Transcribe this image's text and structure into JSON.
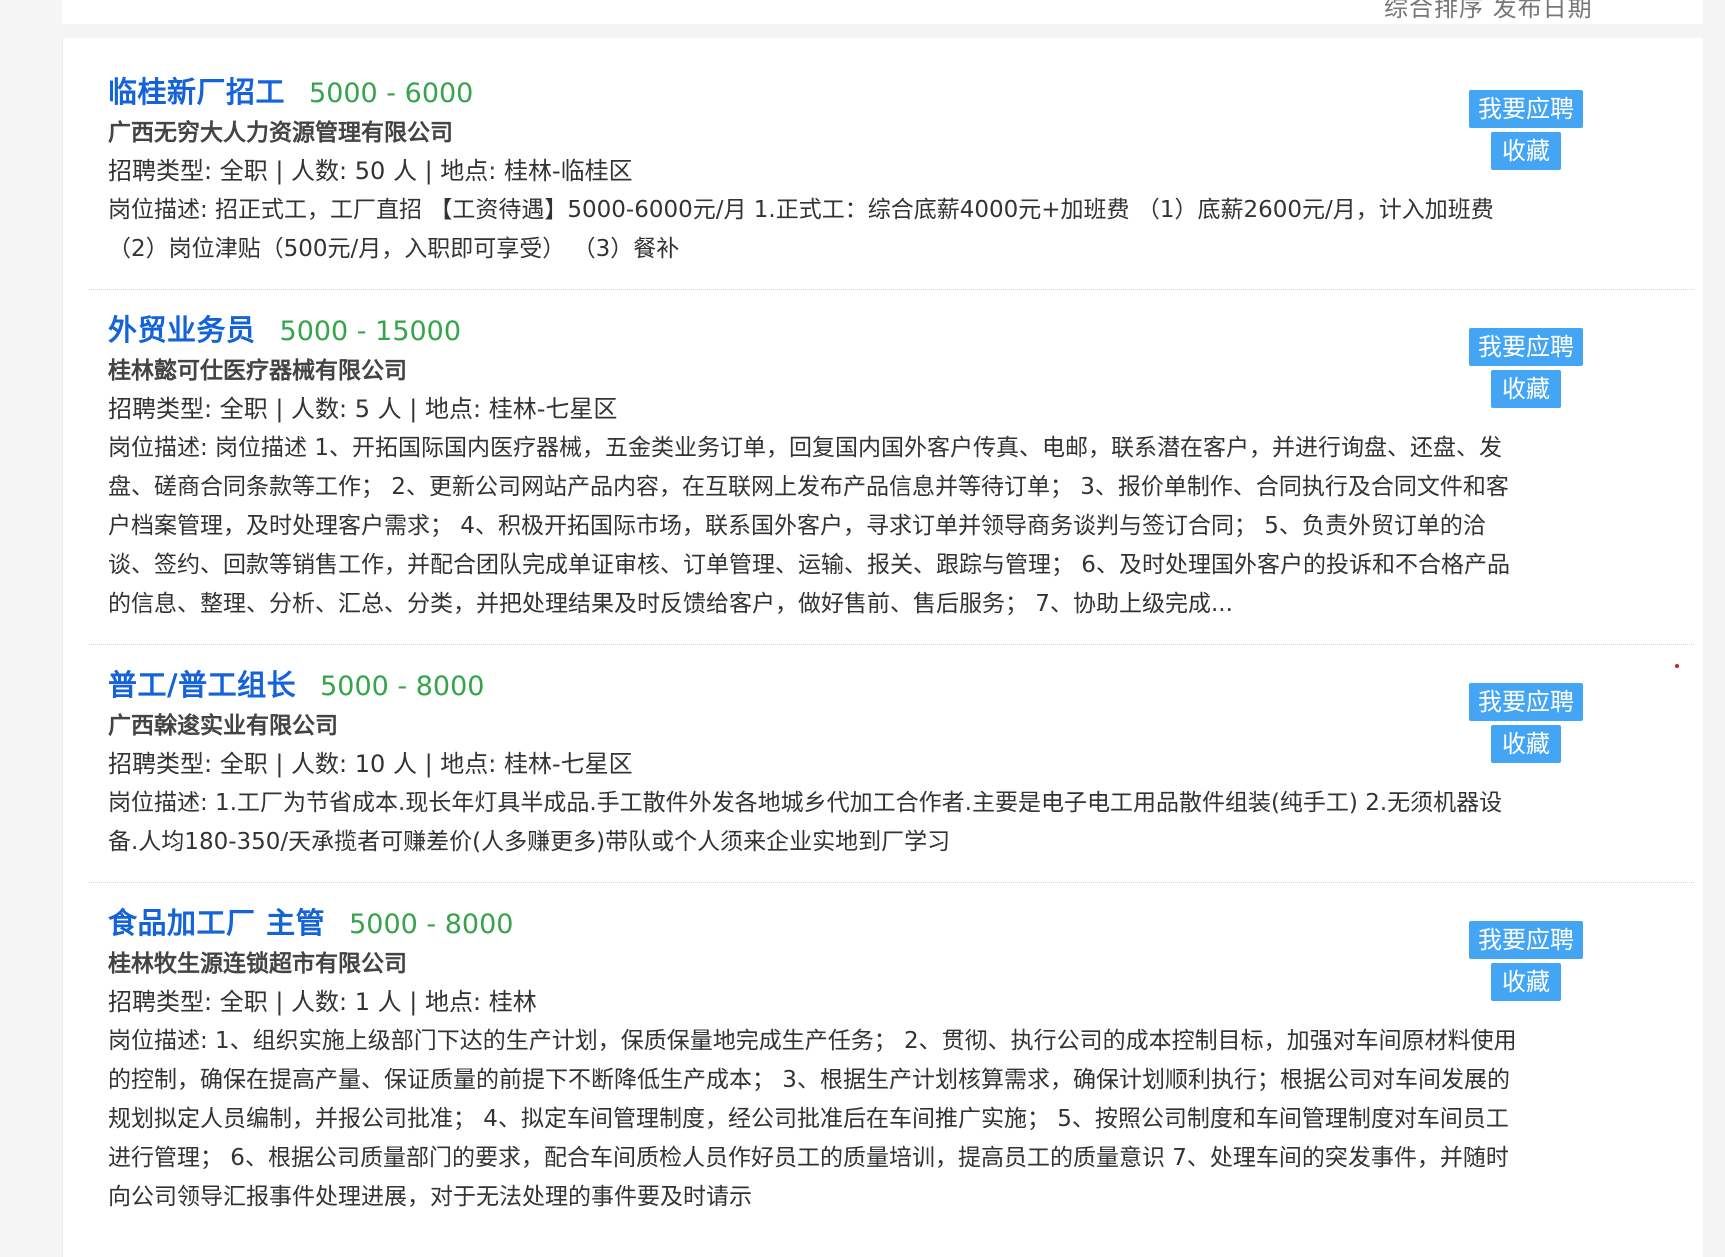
{
  "header": {
    "cut_text": "综合排序    发布日期"
  },
  "jobs": [
    {
      "title": "临桂新厂招工",
      "salary": "5000 - 6000",
      "company": "广西无穷大人力资源管理有限公司",
      "meta": "招聘类型:  全职 | 人数:  50 人 | 地点:  桂林-临桂区",
      "description": "岗位描述:  招正式工，工厂直招 【工资待遇】5000-6000元/月 1.正式工：综合底薪4000元+加班费 （1）底薪2600元/月，计入加班费 （2）岗位津贴（500元/月，入职即可享受） （3）餐补",
      "apply_label": "我要应聘",
      "favorite_label": "收藏"
    },
    {
      "title": "外贸业务员",
      "salary": "5000 - 15000",
      "company": "桂林懿可仕医疗器械有限公司",
      "meta": "招聘类型:  全职 | 人数:  5 人 | 地点:  桂林-七星区",
      "description": "岗位描述:  岗位描述 1、开拓国际国内医疗器械，五金类业务订单，回复国内国外客户传真、电邮，联系潜在客户，并进行询盘、还盘、发盘、磋商合同条款等工作； 2、更新公司网站产品内容，在互联网上发布产品信息并等待订单； 3、报价单制作、合同执行及合同文件和客户档案管理，及时处理客户需求； 4、积极开拓国际市场，联系国外客户，寻求订单并领导商务谈判与签订合同； 5、负责外贸订单的洽谈、签约、回款等销售工作，并配合团队完成单证审核、订单管理、运输、报关、跟踪与管理； 6、及时处理国外客户的投诉和不合格产品的信息、整理、分析、汇总、分类，并把处理结果及时反馈给客户，做好售前、售后服务； 7、协助上级完成...",
      "apply_label": "我要应聘",
      "favorite_label": "收藏"
    },
    {
      "title": "普工/普工组长",
      "salary": "5000 - 8000",
      "company": "广西榦逡实业有限公司",
      "meta": "招聘类型:  全职 | 人数:  10 人 | 地点:  桂林-七星区",
      "description": "岗位描述:  1.工厂为节省成本.现长年灯具半成品.手工散件外发各地城乡代加工合作者.主要是电子电工用品散件组装(纯手工) 2.无须机器设备.人均180-350/天承揽者可赚差价(人多赚更多)带队或个人须来企业实地到厂学习",
      "apply_label": "我要应聘",
      "favorite_label": "收藏"
    },
    {
      "title": "食品加工厂 主管",
      "salary": "5000 - 8000",
      "company": "桂林牧生源连锁超市有限公司",
      "meta": "招聘类型:  全职 | 人数:  1 人 | 地点:  桂林",
      "description": "岗位描述:  1、组织实施上级部门下达的生产计划，保质保量地完成生产任务；        2、贯彻、执行公司的成本控制目标，加强对车间原材料使用的控制，确保在提高产量、保证质量的前提下不断降低生产成本；        3、根据生产计划核算需求，确保计划顺利执行；根据公司对车间发展的规划拟定人员编制，并报公司批准；        4、拟定车间管理制度，经公司批准后在车间推广实施；        5、按照公司制度和车间管理制度对车间员工进行管理；        6、根据公司质量部门的要求，配合车间质检人员作好员工的质量培训，提高员工的质量意识 7、处理车间的突发事件，并随时向公司领导汇报事件处理进展，对于无法处理的事件要及时请示",
      "apply_label": "我要应聘",
      "favorite_label": "收藏"
    }
  ]
}
